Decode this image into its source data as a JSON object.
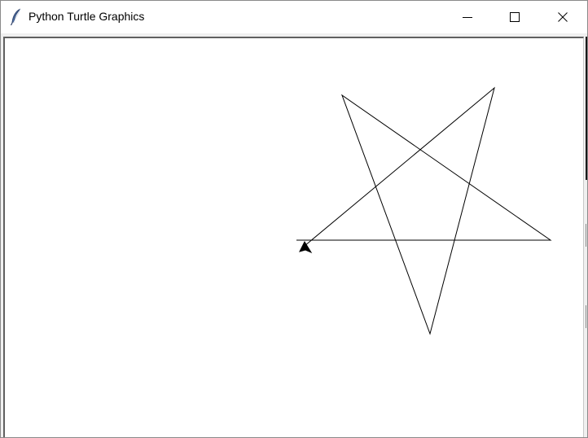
{
  "window": {
    "title": "Python Turtle Graphics",
    "icon": "feather-icon",
    "controls": {
      "minimize_icon": "minimize-icon",
      "maximize_icon": "maximize-icon",
      "close_icon": "close-icon"
    }
  },
  "canvas": {
    "background": "#ffffff",
    "pen_color": "#000000",
    "drawing": "five-pointed star",
    "turtle_cursor": "arrow-icon"
  }
}
